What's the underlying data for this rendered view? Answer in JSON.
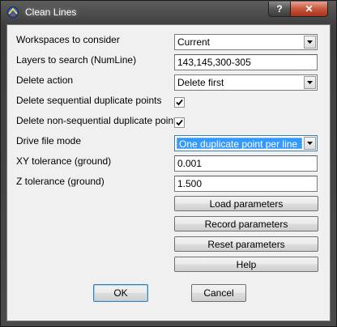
{
  "window": {
    "title": "Clean Lines",
    "help_glyph": "?",
    "close_glyph": "✕"
  },
  "form": {
    "workspaces": {
      "label": "Workspaces to consider",
      "value": "Current"
    },
    "layers": {
      "label": "Layers to search (NumLine)",
      "value": "143,145,300-305"
    },
    "delete_action": {
      "label": "Delete action",
      "value": "Delete first"
    },
    "seq_duplicates": {
      "label": "Delete sequential duplicate points",
      "checked": true
    },
    "nonseq_duplicates": {
      "label": "Delete non-sequential duplicate points",
      "checked": true
    },
    "drive_mode": {
      "label": "Drive file mode",
      "value": "One duplicate point per line"
    },
    "xy_tolerance": {
      "label": "XY tolerance (ground)",
      "value": "0.001"
    },
    "z_tolerance": {
      "label": "Z tolerance (ground)",
      "value": "1.500"
    }
  },
  "buttons": {
    "load": "Load parameters",
    "record": "Record parameters",
    "reset": "Reset parameters",
    "help": "Help",
    "ok": "OK",
    "cancel": "Cancel"
  },
  "icons": {
    "app": "app-icon",
    "dropdown": "chevron-down-icon",
    "check": "checkmark-icon"
  },
  "colors": {
    "selection": "#3399ff",
    "close_button": "#c6573d",
    "dialog_bg": "#f0f0f0"
  }
}
